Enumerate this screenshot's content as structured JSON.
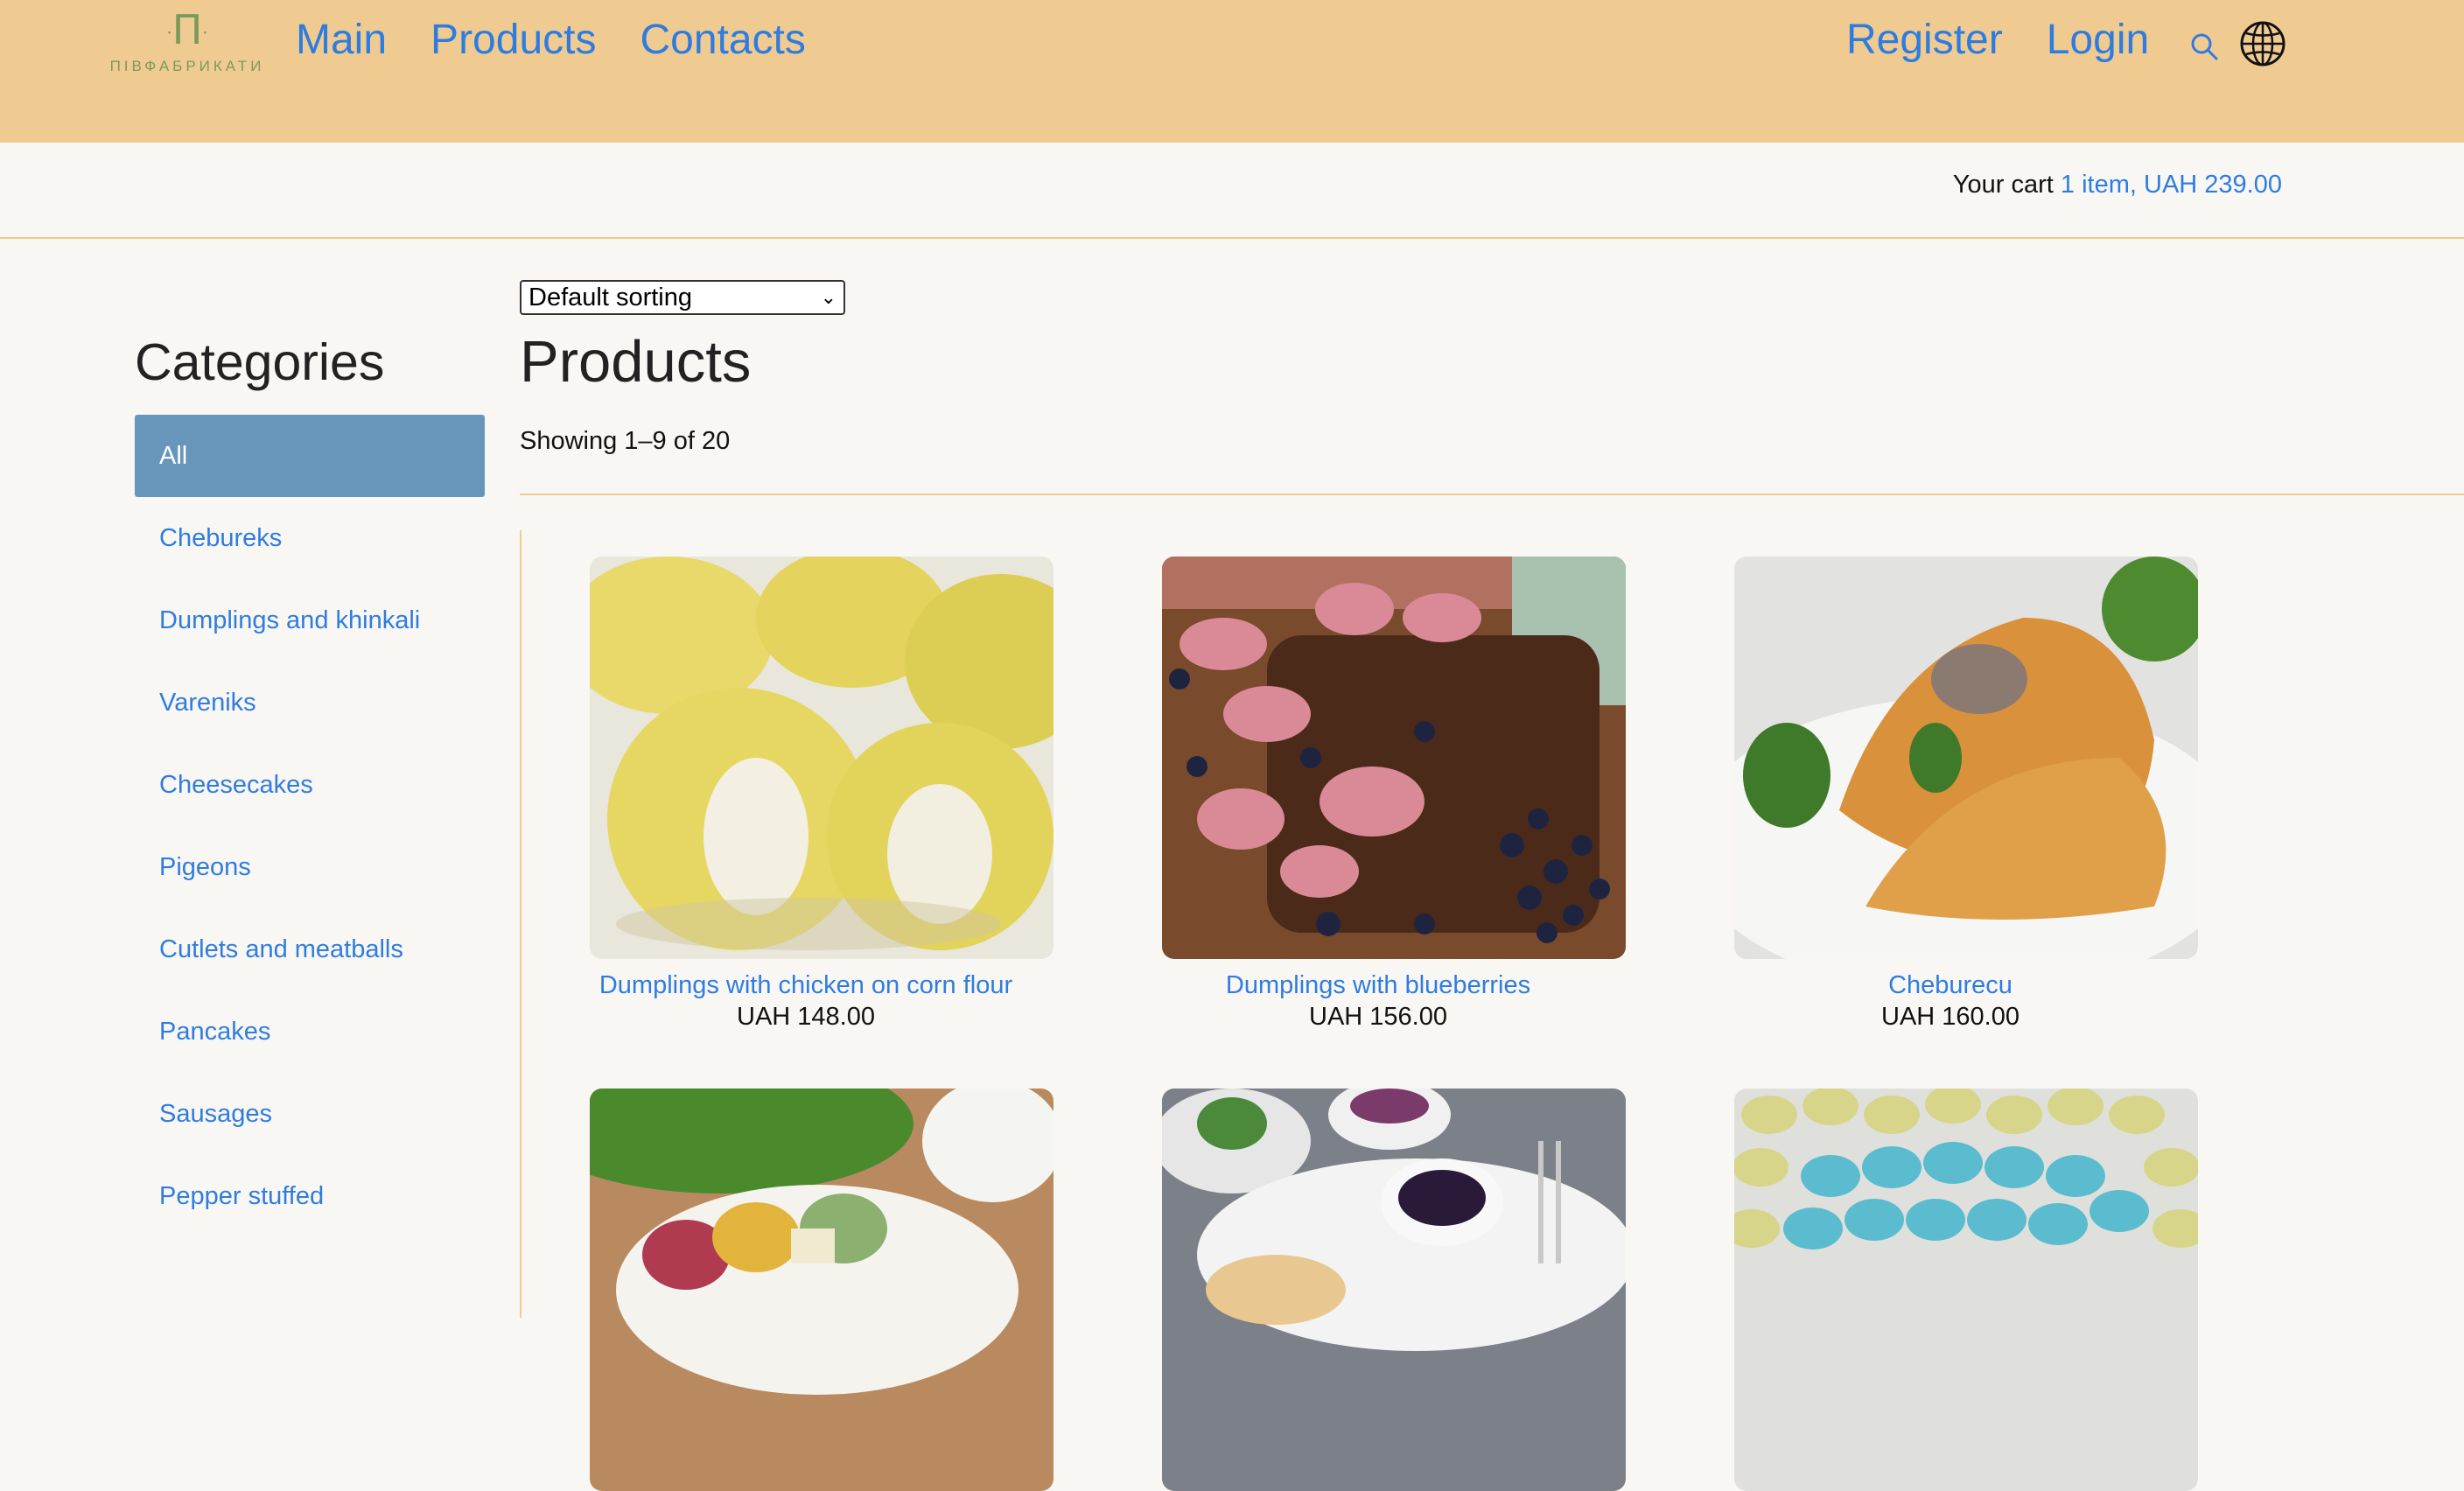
{
  "header": {
    "logo_mark": "П",
    "logo_text": "ПІВФАБРИКАТИ",
    "nav_left": [
      "Main",
      "Products",
      "Contacts"
    ],
    "nav_right": [
      "Register",
      "Login"
    ],
    "icons": [
      "search-icon",
      "globe-icon"
    ],
    "bg_color": "#efcb91"
  },
  "cart": {
    "label": "Your cart",
    "value": "1 item, UAH 239.00"
  },
  "sidebar": {
    "title": "Categories",
    "items": [
      "All",
      "Chebureks",
      "Dumplings and khinkali",
      "Vareniks",
      "Cheesecakes",
      "Pigeons",
      "Cutlets and meatballs",
      "Pancakes",
      "Sausages",
      "Pepper stuffed"
    ],
    "active_index": 0,
    "active_color": "#6895ba"
  },
  "main": {
    "sort_selected": "Default sorting",
    "title": "Products",
    "showing": "Showing 1–9 of 20"
  },
  "products": [
    {
      "name": "Dumplings with chicken on corn flour",
      "price": "UAH 148.00"
    },
    {
      "name": "Dumplings with blueberries",
      "price": "UAH 156.00"
    },
    {
      "name": "Cheburecu",
      "price": "UAH 160.00"
    },
    {
      "name": "",
      "price": ""
    },
    {
      "name": "",
      "price": ""
    },
    {
      "name": "",
      "price": ""
    }
  ],
  "link_color": "#2f7ce0"
}
